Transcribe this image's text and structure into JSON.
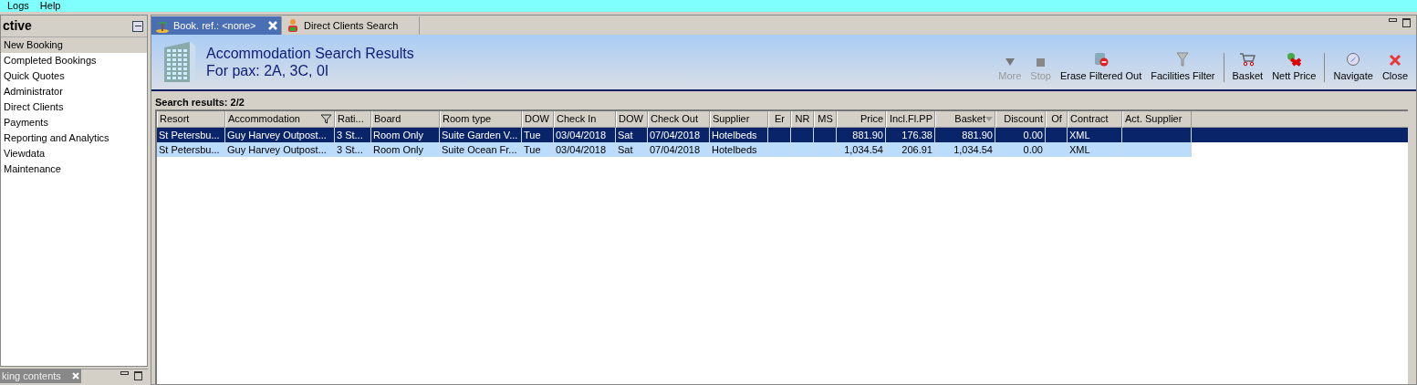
{
  "menu": [
    "Logs",
    "Help"
  ],
  "sidebar": {
    "title": "ctive",
    "items": [
      {
        "label": "New Booking",
        "selected": true
      },
      {
        "label": "Completed Bookings",
        "selected": false
      },
      {
        "label": "Quick Quotes",
        "selected": false
      },
      {
        "label": "Administrator",
        "selected": false
      },
      {
        "label": "Direct Clients",
        "selected": false
      },
      {
        "label": "Payments",
        "selected": false
      },
      {
        "label": "Reporting and Analytics",
        "selected": false
      },
      {
        "label": "Viewdata",
        "selected": false
      },
      {
        "label": "Maintenance",
        "selected": false
      }
    ]
  },
  "bottom_tab": {
    "label": "king contents"
  },
  "tabs": [
    {
      "label": "Book. ref.: <none>",
      "selected": true
    },
    {
      "label": "Direct Clients Search",
      "selected": false
    }
  ],
  "header": {
    "title": "Accommodation Search Results",
    "subtitle": "For pax: 2A, 3C, 0I"
  },
  "toolbar": [
    {
      "kind": "more",
      "label": "More",
      "disabled": true
    },
    {
      "kind": "stop",
      "label": "Stop",
      "disabled": true
    },
    {
      "kind": "erase",
      "label": "Erase Filtered Out",
      "disabled": false
    },
    {
      "kind": "filter",
      "label": "Facilities Filter",
      "disabled": false
    },
    {
      "kind": "separator"
    },
    {
      "kind": "basket",
      "label": "Basket",
      "disabled": false
    },
    {
      "kind": "nett",
      "label": "Nett Price",
      "disabled": false
    },
    {
      "kind": "separator"
    },
    {
      "kind": "navigate",
      "label": "Navigate",
      "disabled": false
    },
    {
      "kind": "close",
      "label": "Close",
      "disabled": false
    }
  ],
  "results_label": "Search results: 2/2",
  "table": {
    "columns": [
      {
        "label": "Resort",
        "filtered": false,
        "sorted": false
      },
      {
        "label": "Accommodation",
        "filtered": true,
        "sorted": false
      },
      {
        "label": "Rati...",
        "filtered": false,
        "sorted": false
      },
      {
        "label": "Board",
        "filtered": false,
        "sorted": false
      },
      {
        "label": "Room type",
        "filtered": false,
        "sorted": false
      },
      {
        "label": "DOW",
        "filtered": false,
        "sorted": false
      },
      {
        "label": "Check In",
        "filtered": false,
        "sorted": false
      },
      {
        "label": "DOW",
        "filtered": false,
        "sorted": false
      },
      {
        "label": "Check Out",
        "filtered": false,
        "sorted": false
      },
      {
        "label": "Supplier",
        "filtered": false,
        "sorted": false
      },
      {
        "label": "Er",
        "filtered": false,
        "sorted": false
      },
      {
        "label": "NR",
        "filtered": false,
        "sorted": false
      },
      {
        "label": "MS",
        "filtered": false,
        "sorted": false
      },
      {
        "label": "Price",
        "filtered": false,
        "sorted": false
      },
      {
        "label": "Incl.Fl.PP",
        "filtered": false,
        "sorted": false
      },
      {
        "label": "Basket",
        "filtered": false,
        "sorted": true
      },
      {
        "label": "Discount",
        "filtered": false,
        "sorted": false
      },
      {
        "label": "Of",
        "filtered": false,
        "sorted": false
      },
      {
        "label": "Contract",
        "filtered": false,
        "sorted": false
      },
      {
        "label": "Act. Supplier",
        "filtered": false,
        "sorted": false
      }
    ],
    "rows": [
      {
        "selected": true,
        "cells": [
          "St Petersbu...",
          "Guy Harvey Outpost...",
          "3 St...",
          "Room Only",
          "Suite Garden V...",
          "Tue",
          "03/04/2018",
          "Sat",
          "07/04/2018",
          "Hotelbeds",
          "",
          "",
          "",
          "881.90",
          "176.38",
          "881.90",
          "0.00",
          "",
          "XML",
          ""
        ]
      },
      {
        "selected": false,
        "cells": [
          "St Petersbu...",
          "Guy Harvey Outpost...",
          "3 St...",
          "Room Only",
          "Suite Ocean Fr...",
          "Tue",
          "03/04/2018",
          "Sat",
          "07/04/2018",
          "Hotelbeds",
          "",
          "",
          "",
          "1,034.54",
          "206.91",
          "1,034.54",
          "0.00",
          "",
          "XML",
          ""
        ]
      }
    ]
  }
}
